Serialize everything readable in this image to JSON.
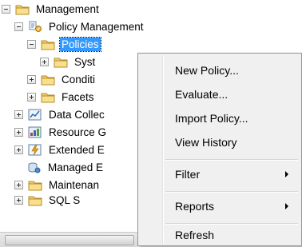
{
  "tree": {
    "management": "Management",
    "policy_management": "Policy Management",
    "policies": "Policies",
    "system": "Syst",
    "conditions": "Conditi",
    "facets": "Facets",
    "data_collection": "Data Collec",
    "resource_governor": "Resource G",
    "extended_events": "Extended E",
    "managed_backup": "Managed E",
    "maintenance": "Maintenan",
    "sql_server": "SQL S"
  },
  "context_menu": {
    "new_policy": "New Policy...",
    "evaluate": "Evaluate...",
    "import_policy": "Import Policy...",
    "view_history": "View History",
    "filter": "Filter",
    "reports": "Reports",
    "refresh": "Refresh"
  },
  "colors": {
    "selection": "#3399ff",
    "menu_background": "#f0f0f0",
    "folder": "#f2cf6a"
  },
  "icons": [
    "folder-icon",
    "policy-management-icon",
    "data-collection-icon",
    "resource-governor-icon",
    "extended-events-icon",
    "managed-backup-icon"
  ]
}
